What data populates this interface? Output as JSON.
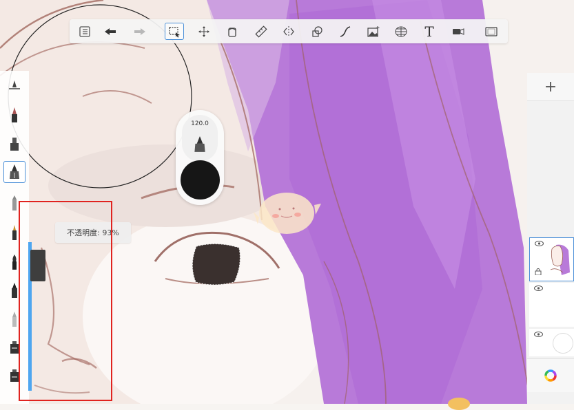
{
  "toolbar": {
    "tools": [
      {
        "name": "menu",
        "icon": "list-icon"
      },
      {
        "name": "undo",
        "icon": "undo-icon"
      },
      {
        "name": "redo",
        "icon": "redo-icon"
      },
      {
        "name": "selection",
        "icon": "selection-icon",
        "active": true
      },
      {
        "name": "transform",
        "icon": "move-icon"
      },
      {
        "name": "fill",
        "icon": "bucket-icon"
      },
      {
        "name": "ruler",
        "icon": "ruler-icon"
      },
      {
        "name": "symmetry",
        "icon": "symmetry-icon"
      },
      {
        "name": "shapes",
        "icon": "shapes-icon"
      },
      {
        "name": "curve",
        "icon": "curve-icon"
      },
      {
        "name": "image",
        "icon": "image-icon"
      },
      {
        "name": "perspective",
        "icon": "perspective-icon"
      },
      {
        "name": "text",
        "icon": "text-icon",
        "glyph": "T"
      },
      {
        "name": "video",
        "icon": "video-icon"
      },
      {
        "name": "fullscreen",
        "icon": "fullscreen-icon"
      }
    ]
  },
  "brushes": {
    "items": [
      "brush-library-icon",
      "pencil-brush-icon",
      "marker-brush-icon",
      "ink-pen-brush-icon",
      "airbrush-icon",
      "pen-brush-icon",
      "paint-brush-icon",
      "ink-brush-icon",
      "smudge-brush-icon",
      "fill-brush-icon",
      "eraser-brush-icon"
    ],
    "active_index": 3
  },
  "opacity": {
    "label": "不透明度: 93%",
    "value": 93
  },
  "brush_size": {
    "value": "120.0",
    "color": "#161616"
  },
  "layers": {
    "add_label": "+",
    "items": [
      {
        "name": "artwork-layer",
        "active": true
      },
      {
        "name": "empty-layer",
        "active": false
      },
      {
        "name": "background-layer",
        "active": false
      }
    ]
  },
  "colors": {
    "accent": "#4a8fd8",
    "hair": "#b57ad8",
    "line": "#9c5f56",
    "highlight": "#e0231f",
    "slider": "#4ea6f0"
  }
}
